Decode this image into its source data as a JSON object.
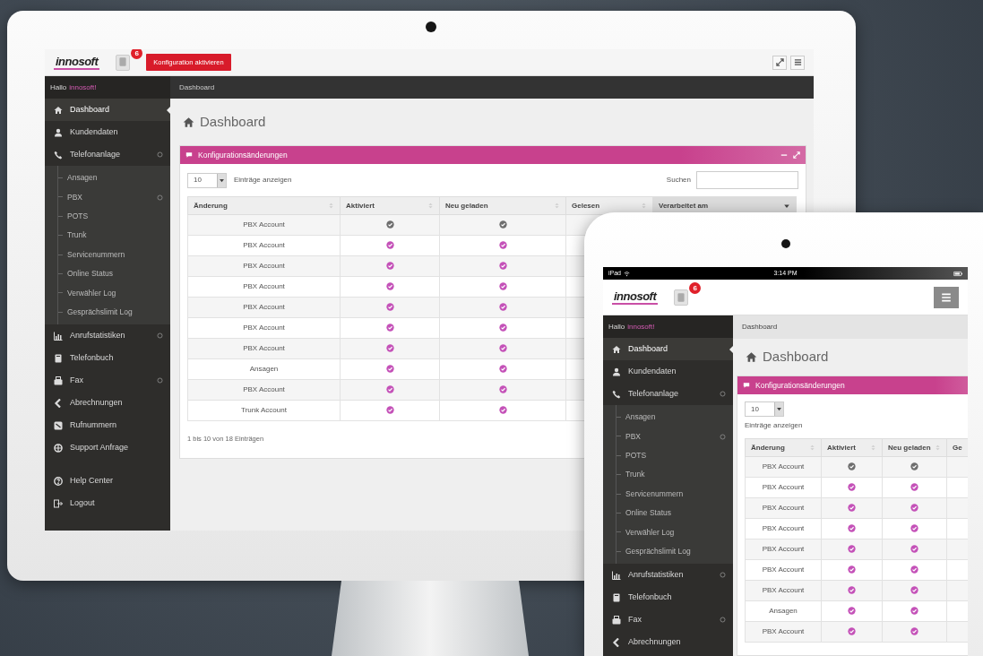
{
  "desktop": {
    "logo": "innosoft",
    "notification_count": "6",
    "config_button": "Konfiguration aktivieren",
    "greeting": "Hallo",
    "user": "innosoft!",
    "breadcrumb": "Dashboard",
    "sidebar": {
      "items": [
        {
          "label": "Dashboard",
          "selected": true,
          "has_submenu": false
        },
        {
          "label": "Kundendaten",
          "selected": false,
          "has_submenu": false
        },
        {
          "label": "Telefonanlage",
          "selected": false,
          "has_submenu": true,
          "children": [
            {
              "label": "Ansagen",
              "selected": false,
              "has_submenu": false
            },
            {
              "label": "PBX",
              "selected": false,
              "has_submenu": true
            },
            {
              "label": "POTS",
              "selected": false,
              "has_submenu": false
            },
            {
              "label": "Trunk",
              "selected": false,
              "has_submenu": false
            },
            {
              "label": "Servicenummern",
              "selected": false,
              "has_submenu": false
            },
            {
              "label": "Online Status",
              "selected": false,
              "has_submenu": false
            },
            {
              "label": "Verwähler Log",
              "selected": false,
              "has_submenu": false
            },
            {
              "label": "Gesprächslimit Log",
              "selected": false,
              "has_submenu": false
            }
          ]
        },
        {
          "label": "Anrufstatistiken",
          "selected": false,
          "has_submenu": true
        },
        {
          "label": "Telefonbuch",
          "selected": false,
          "has_submenu": false
        },
        {
          "label": "Fax",
          "selected": false,
          "has_submenu": true
        },
        {
          "label": "Abrechnungen",
          "selected": false,
          "has_submenu": false
        },
        {
          "label": "Rufnummern",
          "selected": false,
          "has_submenu": false
        },
        {
          "label": "Support Anfrage",
          "selected": false,
          "has_submenu": false
        }
      ],
      "footer_items": [
        {
          "label": "Help Center",
          "selected": false,
          "has_submenu": false
        },
        {
          "label": "Logout",
          "selected": false,
          "has_submenu": false
        }
      ]
    },
    "page_title": "Dashboard",
    "panel": {
      "title": "Konfigurationsänderungen",
      "length": {
        "value": "10",
        "label": "Einträge anzeigen"
      },
      "search": {
        "label": "Suchen"
      },
      "table": {
        "columns": [
          {
            "label": "Änderung",
            "sorted_desc": false
          },
          {
            "label": "Aktiviert",
            "sorted_desc": false
          },
          {
            "label": "Neu geladen",
            "sorted_desc": false
          },
          {
            "label": "Gelesen",
            "sorted_desc": false
          },
          {
            "label": "Verarbeitet am",
            "sorted_desc": true
          }
        ],
        "rows": [
          {
            "change": "PBX Account",
            "activated": false,
            "reloaded": false
          },
          {
            "change": "PBX Account",
            "activated": true,
            "reloaded": true
          },
          {
            "change": "PBX Account",
            "activated": true,
            "reloaded": true
          },
          {
            "change": "PBX Account",
            "activated": true,
            "reloaded": true
          },
          {
            "change": "PBX Account",
            "activated": true,
            "reloaded": true
          },
          {
            "change": "PBX Account",
            "activated": true,
            "reloaded": true
          },
          {
            "change": "PBX Account",
            "activated": true,
            "reloaded": true
          },
          {
            "change": "Ansagen",
            "activated": true,
            "reloaded": true
          },
          {
            "change": "PBX Account",
            "activated": true,
            "reloaded": true
          },
          {
            "change": "Trunk Account",
            "activated": true,
            "reloaded": true
          }
        ]
      },
      "info": "1 bis 10 von 18 Einträgen"
    }
  },
  "tablet": {
    "status_bar": {
      "carrier": "iPad",
      "time": "3:14 PM"
    },
    "logo": "innosoft",
    "notification_count": "6",
    "greeting": "Hallo",
    "user": "innosoft!",
    "breadcrumb": "Dashboard",
    "sidebar": {
      "items": [
        {
          "label": "Dashboard",
          "selected": true,
          "has_submenu": false
        },
        {
          "label": "Kundendaten",
          "selected": false,
          "has_submenu": false
        },
        {
          "label": "Telefonanlage",
          "selected": false,
          "has_submenu": true,
          "children": [
            {
              "label": "Ansagen",
              "selected": false,
              "has_submenu": false
            },
            {
              "label": "PBX",
              "selected": false,
              "has_submenu": true
            },
            {
              "label": "POTS",
              "selected": false,
              "has_submenu": false
            },
            {
              "label": "Trunk",
              "selected": false,
              "has_submenu": false
            },
            {
              "label": "Servicenummern",
              "selected": false,
              "has_submenu": false
            },
            {
              "label": "Online Status",
              "selected": false,
              "has_submenu": false
            },
            {
              "label": "Verwähler Log",
              "selected": false,
              "has_submenu": false
            },
            {
              "label": "Gesprächslimit Log",
              "selected": false,
              "has_submenu": false
            }
          ]
        },
        {
          "label": "Anrufstatistiken",
          "selected": false,
          "has_submenu": true
        },
        {
          "label": "Telefonbuch",
          "selected": false,
          "has_submenu": false
        },
        {
          "label": "Fax",
          "selected": false,
          "has_submenu": true
        },
        {
          "label": "Abrechnungen",
          "selected": false,
          "has_submenu": false
        }
      ]
    },
    "page_title": "Dashboard",
    "panel": {
      "title": "Konfigurationsänderungen",
      "length": {
        "value": "10",
        "label": "Einträge anzeigen"
      },
      "table": {
        "columns": [
          {
            "label": "Änderung",
            "sorted_desc": false
          },
          {
            "label": "Aktiviert",
            "sorted_desc": false
          },
          {
            "label": "Neu geladen",
            "sorted_desc": false
          },
          {
            "label": "Ge"
          }
        ],
        "rows": [
          {
            "change": "PBX Account",
            "activated": false,
            "reloaded": false
          },
          {
            "change": "PBX Account",
            "activated": true,
            "reloaded": true
          },
          {
            "change": "PBX Account",
            "activated": true,
            "reloaded": true
          },
          {
            "change": "PBX Account",
            "activated": true,
            "reloaded": true
          },
          {
            "change": "PBX Account",
            "activated": true,
            "reloaded": true
          },
          {
            "change": "PBX Account",
            "activated": true,
            "reloaded": true
          },
          {
            "change": "PBX Account",
            "activated": true,
            "reloaded": true
          },
          {
            "change": "Ansagen",
            "activated": true,
            "reloaded": true
          },
          {
            "change": "PBX Account",
            "activated": true,
            "reloaded": true
          }
        ]
      }
    }
  }
}
